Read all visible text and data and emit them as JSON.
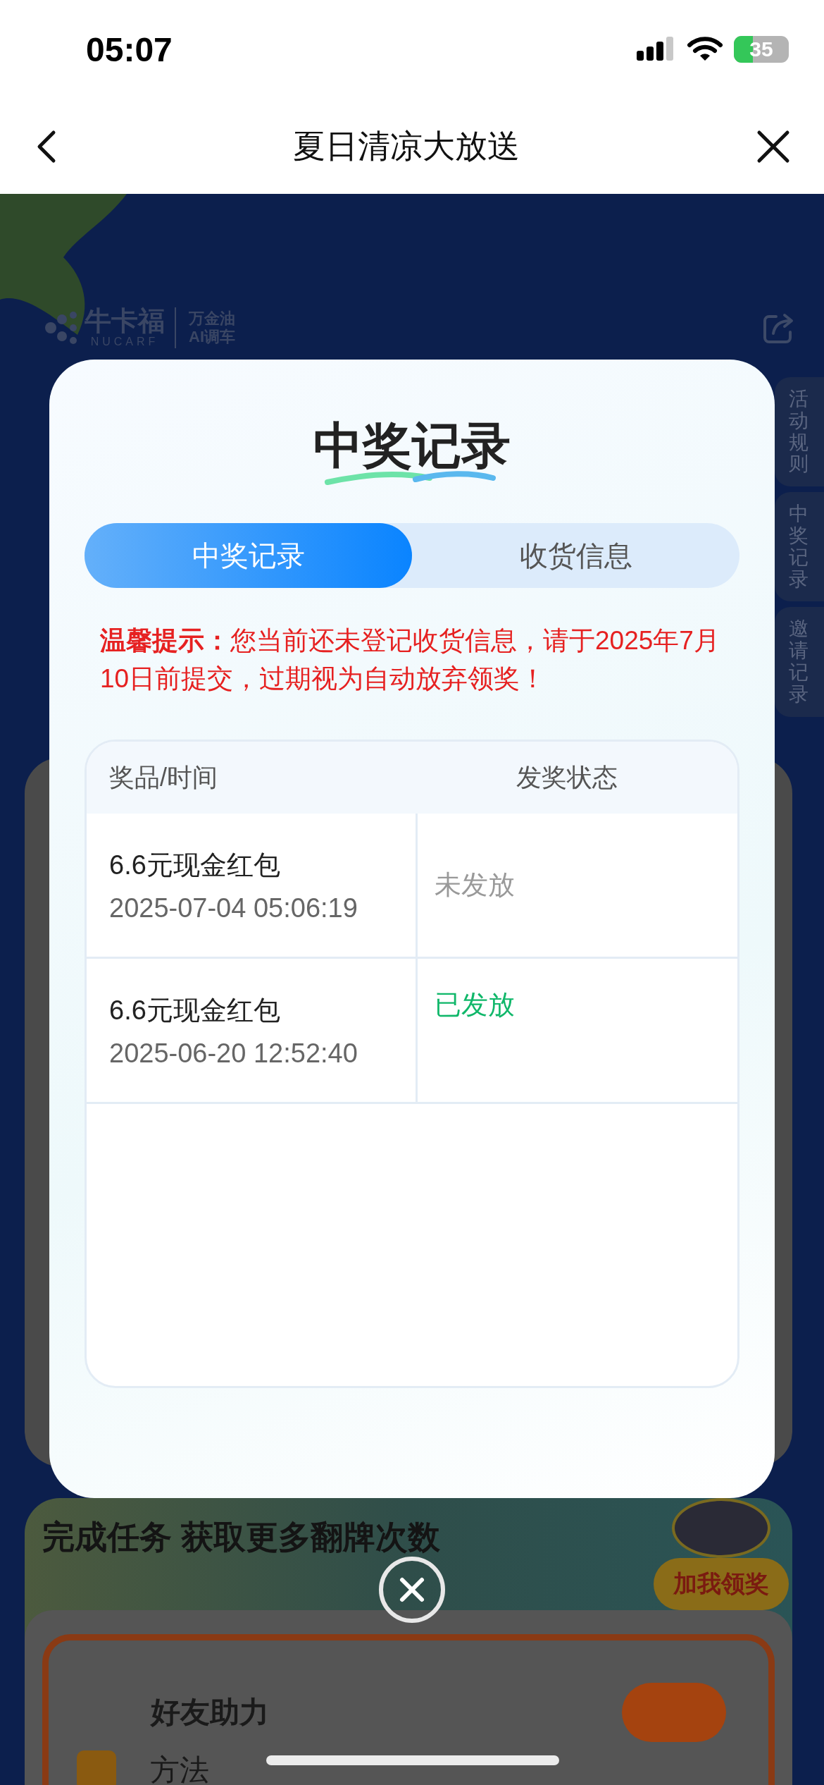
{
  "status_bar": {
    "time": "05:07",
    "battery": "35"
  },
  "nav": {
    "title": "夏日清凉大放送"
  },
  "background": {
    "logo_name": "牛卡福",
    "logo_sub": "NUCARF",
    "logo_tagline_1": "万金油",
    "logo_tagline_2": "AI调车",
    "side_tabs": [
      "活动规则",
      "中奖记录",
      "邀请记录"
    ],
    "task_title": "完成任务 获取更多翻牌次数",
    "avatar_button": "加我领奖",
    "task_name": "好友助力",
    "task_label": "方法"
  },
  "modal": {
    "title": "中奖记录",
    "tabs": [
      {
        "label": "中奖记录",
        "selected": true
      },
      {
        "label": "收货信息",
        "selected": false
      }
    ],
    "notice": "**温馨提示：**您当前还未登记收货信息，请于2025年7月10日前提交，过期视为自动放弃领奖！",
    "table": {
      "columns": [
        "奖品/时间",
        "发奖状态"
      ],
      "rows": [
        {
          "prize": "6.6元现金红包",
          "time": "2025-07-04 05:06:19",
          "status": "未发放",
          "kind": "pending"
        },
        {
          "prize": "6.6元现金红包",
          "time": "2025-06-20 12:52:40",
          "status": "已发放",
          "kind": "issued"
        }
      ]
    }
  }
}
